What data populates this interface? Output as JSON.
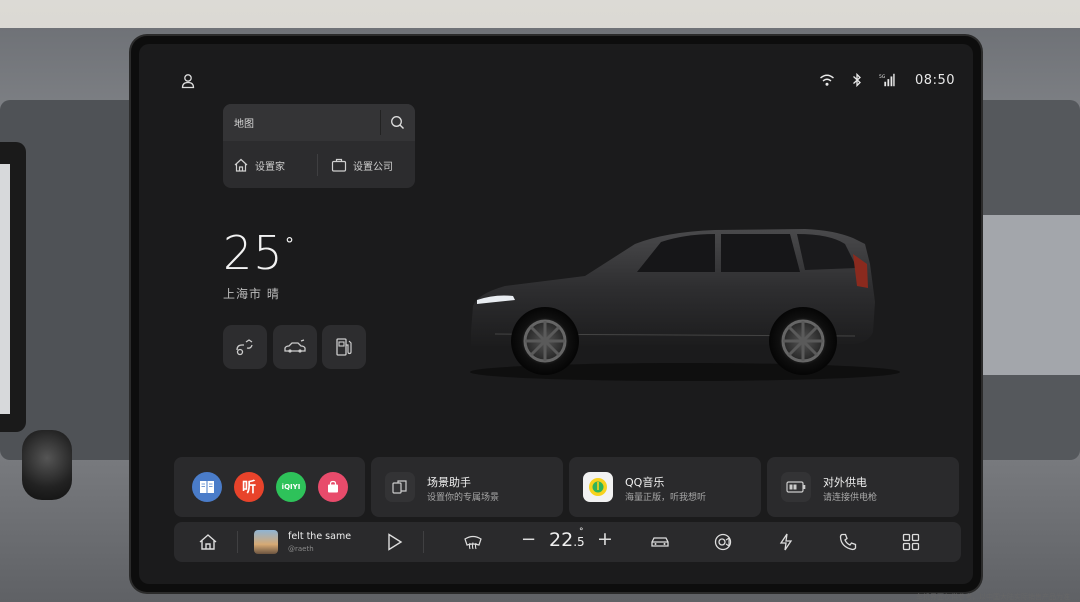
{
  "status_bar": {
    "time": "08:50",
    "signal_label": "5G",
    "icons": [
      "user-icon",
      "wifi-icon",
      "bluetooth-icon",
      "5g-signal-icon"
    ]
  },
  "navigation": {
    "search_label": "地图",
    "home_label": "设置家",
    "work_label": "设置公司"
  },
  "weather": {
    "temperature": "25",
    "degree_symbol": "°",
    "location_condition": "上海市 晴"
  },
  "quick_controls": [
    "charge-port-icon",
    "car-trunk-icon",
    "fuel-station-icon"
  ],
  "app_cards": {
    "apps": [
      {
        "name": "book-app",
        "color": "#4a7cc9",
        "glyph": "📖"
      },
      {
        "name": "ting-app",
        "color": "#e8432b",
        "glyph": "听"
      },
      {
        "name": "iqiyi-app",
        "color": "#2ec25a",
        "glyph": "iQIYI"
      },
      {
        "name": "shopping-app",
        "color": "#e84b6b",
        "glyph": "🛍"
      }
    ],
    "scene": {
      "title": "场景助手",
      "subtitle": "设置你的专属场景"
    },
    "music": {
      "title": "QQ音乐",
      "subtitle": "海量正版，听我想听"
    },
    "power": {
      "title": "对外供电",
      "subtitle": "请连接供电枪"
    }
  },
  "dock": {
    "song_title": "felt the same",
    "artist": "@raeth",
    "temperature_int": "22",
    "temperature_dec": ".5",
    "temperature_deg": "°",
    "minus": "−",
    "plus": "+"
  },
  "disclaimer": "车机界面仅供参考，以中国大陆实际销售产品为准"
}
